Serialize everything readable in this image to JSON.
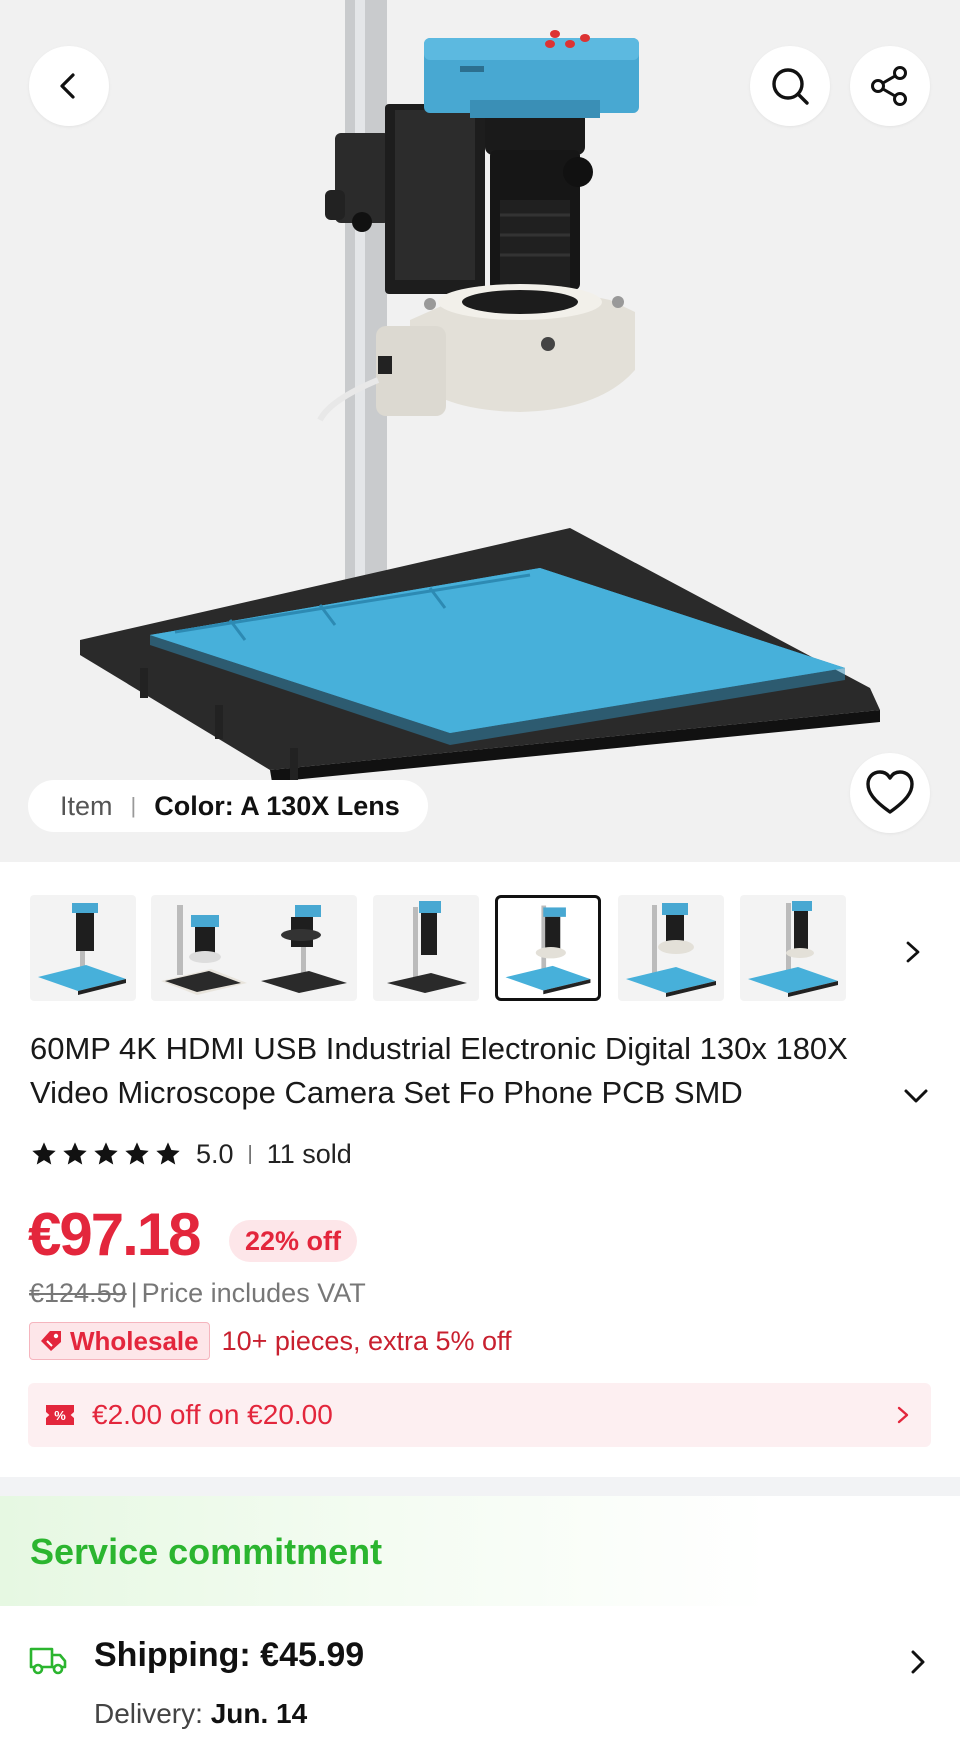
{
  "header": {
    "back_icon": "chevron-left-icon",
    "search_icon": "search-icon",
    "share_icon": "share-icon",
    "favorite_icon": "heart-icon"
  },
  "gallery": {
    "variant_label": "Item",
    "variant_value": "Color: A 130X Lens",
    "thumbnail_count": 7,
    "active_thumbnail": 5
  },
  "product": {
    "title": "60MP 4K HDMI USB Industrial Electronic Digital 130x 180X Video Microscope Camera Set Fo Phone PCB SMD",
    "rating": "5.0",
    "sold": "11 sold",
    "stars": 5
  },
  "pricing": {
    "price": "€97.18",
    "discount": "22% off",
    "original_price": "€124.59",
    "separator": "|",
    "vat_note": "Price includes VAT",
    "wholesale_badge": "Wholesale",
    "wholesale_text": "10+ pieces, extra 5% off",
    "coupon_badge": "%",
    "coupon_text": "€2.00 off on €20.00"
  },
  "service": {
    "title": "Service commitment",
    "shipping_label": "Shipping: €45.99",
    "delivery_label": "Delivery:",
    "delivery_date": "Jun. 14"
  },
  "colors": {
    "accent_red": "#e3263c",
    "service_green": "#2bb52f",
    "mat_blue": "#3fa4cf"
  }
}
